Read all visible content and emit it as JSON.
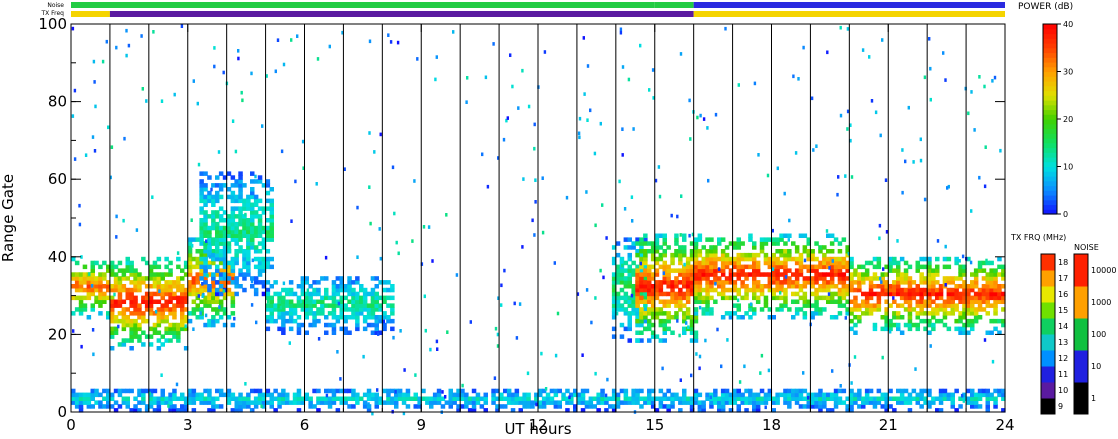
{
  "chart_data": {
    "type": "heatmap",
    "xlabel": "UT hours",
    "ylabel": "Range Gate",
    "xlim": [
      0,
      24
    ],
    "ylim": [
      0,
      100
    ],
    "x_ticks": [
      "0",
      "3",
      "6",
      "9",
      "12",
      "15",
      "18",
      "21",
      "24"
    ],
    "y_ticks": [
      "0",
      "20",
      "40",
      "60",
      "80",
      "100"
    ],
    "scan_boundaries_ut": [
      1,
      2,
      3,
      4,
      5,
      6,
      7,
      8,
      9,
      10,
      11,
      12,
      13,
      14,
      15,
      16,
      17,
      18,
      19,
      20,
      21,
      22,
      23
    ],
    "echo_regions": [
      {
        "ut": [
          0,
          1
        ],
        "gate": [
          24,
          40
        ],
        "peak_db": 34
      },
      {
        "ut": [
          1,
          3
        ],
        "gate": [
          16,
          40
        ],
        "peak_db": 38
      },
      {
        "ut": [
          3,
          4.2
        ],
        "gate": [
          22,
          45
        ],
        "peak_db": 34
      },
      {
        "ut": [
          3.3,
          5.1
        ],
        "gate": [
          30,
          62
        ],
        "peak_db": 14
      },
      {
        "ut": [
          5,
          8.2
        ],
        "gate": [
          20,
          35
        ],
        "peak_db": 14
      },
      {
        "ut": [
          13.9,
          14.7
        ],
        "gate": [
          18,
          46
        ],
        "peak_db": 16
      },
      {
        "ut": [
          14.5,
          16
        ],
        "gate": [
          18,
          46
        ],
        "peak_db": 38
      },
      {
        "ut": [
          16,
          20
        ],
        "gate": [
          24,
          46
        ],
        "peak_db": 38
      },
      {
        "ut": [
          20,
          24
        ],
        "gate": [
          20,
          40
        ],
        "peak_db": 38
      },
      {
        "ut": [
          0,
          24
        ],
        "gate": [
          0,
          6
        ],
        "peak_db": 10
      }
    ],
    "power_colorbar": {
      "label": "POWER (dB)",
      "range": [
        0,
        40
      ],
      "ticks": [
        "0",
        "10",
        "20",
        "30",
        "40"
      ]
    },
    "txfreq_colorbar": {
      "label": "TX FRQ (MHz)",
      "range": [
        9,
        18
      ],
      "ticks": [
        "9",
        "10",
        "11",
        "12",
        "13",
        "14",
        "15",
        "16",
        "17",
        "18"
      ]
    },
    "noise_colorbar": {
      "label": "NOISE",
      "ticks": [
        "1",
        "10",
        "100",
        "1000",
        "10000"
      ],
      "scale": "log"
    },
    "status_bars": {
      "noise_label": "Noise",
      "txfreq_label": "TX Freq",
      "txfreq_segments": [
        {
          "ut": [
            0,
            1
          ],
          "color": "#f5d400"
        },
        {
          "ut": [
            1,
            16
          ],
          "color": "#5a1aa0"
        },
        {
          "ut": [
            16,
            24
          ],
          "color": "#f5d400"
        }
      ],
      "noise_segments": [
        {
          "ut": [
            0,
            15
          ],
          "color": "#22cc44"
        },
        {
          "ut": [
            15,
            16
          ],
          "color": "#22cc44"
        },
        {
          "ut": [
            16,
            24
          ],
          "color": "#2a2ae0"
        }
      ]
    }
  }
}
